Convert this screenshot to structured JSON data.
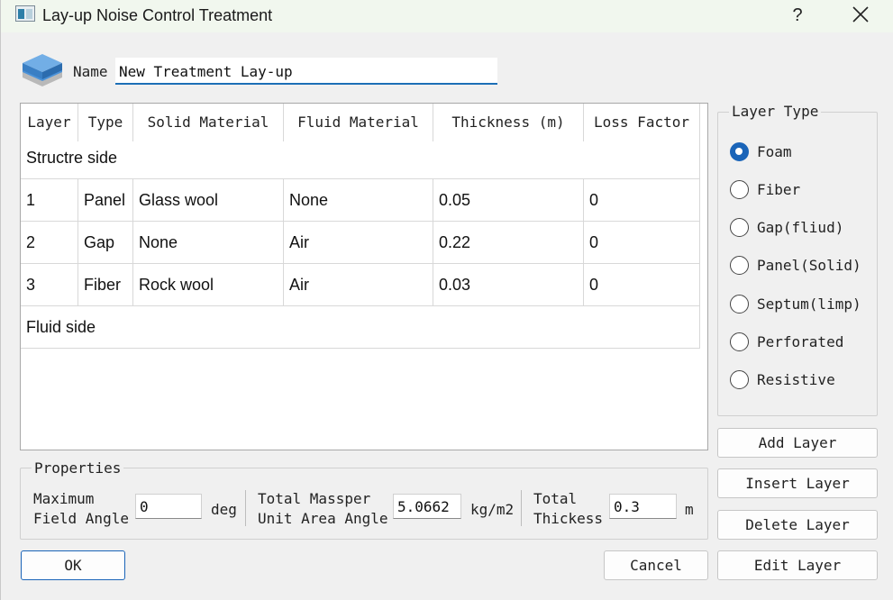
{
  "window": {
    "title": "Lay-up Noise Control Treatment",
    "help": "?"
  },
  "name_row": {
    "label": "Name",
    "value": "New Treatment Lay-up"
  },
  "table": {
    "headers": [
      "Layer",
      "Type",
      "Solid Material",
      "Fluid Material",
      "Thickness (m)",
      "Loss Factor"
    ],
    "structure_label": "Structre side",
    "fluid_label": "Fluid side",
    "rows": [
      {
        "layer": "1",
        "type": "Panel",
        "solid": "Glass wool",
        "fluid": "None",
        "thickness": "0.05",
        "loss": "0"
      },
      {
        "layer": "2",
        "type": "Gap",
        "solid": "None",
        "fluid": "Air",
        "thickness": "0.22",
        "loss": "0"
      },
      {
        "layer": "3",
        "type": "Fiber",
        "solid": "Rock wool",
        "fluid": "Air",
        "thickness": "0.03",
        "loss": "0"
      }
    ]
  },
  "layer_type": {
    "title": "Layer Type",
    "options": [
      "Foam",
      "Fiber",
      "Gap(fliud)",
      "Panel(Solid)",
      "Septum(limp)",
      "Perforated",
      "Resistive"
    ],
    "selected": "Foam"
  },
  "side_buttons": {
    "add": "Add Layer",
    "insert": "Insert Layer",
    "delete": "Delete Layer",
    "edit": "Edit Layer"
  },
  "properties": {
    "title": "Properties",
    "max_angle_line1": "Maximum",
    "max_angle_line2": "Field Angle",
    "max_angle_value": "0",
    "max_angle_unit": "deg",
    "mass_line1": "Total Massper",
    "mass_line2": "Unit Area Angle",
    "mass_value": "5.0662",
    "mass_unit": "kg/m2",
    "thick_line1": "Total",
    "thick_line2": "Thickess",
    "thick_value": "0.3",
    "thick_unit": "m"
  },
  "footer": {
    "ok": "OK",
    "cancel": "Cancel"
  },
  "colors": {
    "accent": "#1a64b8",
    "titlebar": "#f1f7ee"
  }
}
